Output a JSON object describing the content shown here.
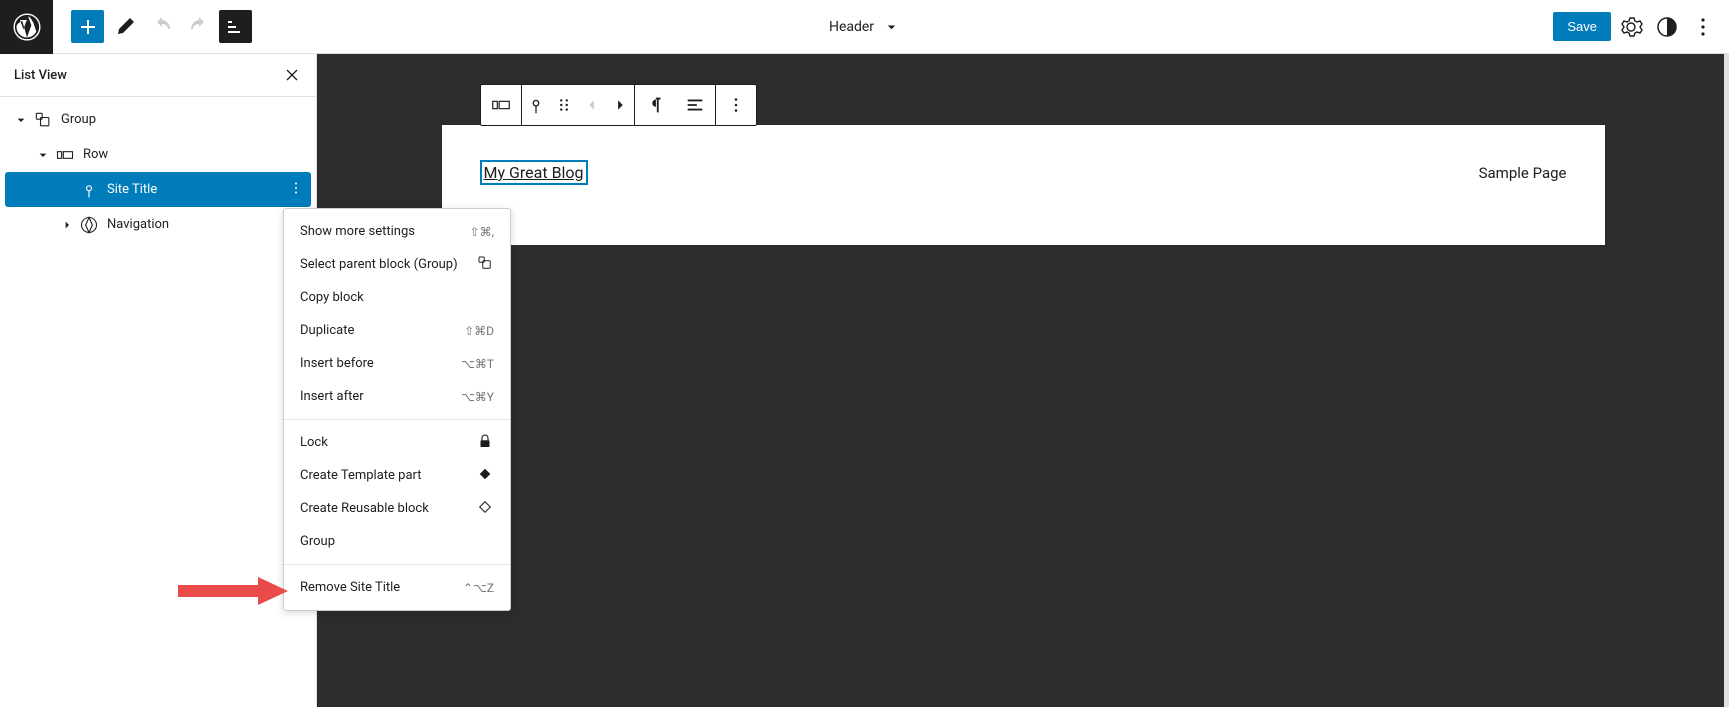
{
  "toolbar": {
    "template_name": "Header",
    "save_label": "Save"
  },
  "sidebar": {
    "panel_title": "List View",
    "tree": {
      "group_label": "Group",
      "row_label": "Row",
      "site_title_label": "Site Title",
      "navigation_label": "Navigation"
    }
  },
  "canvas": {
    "site_title_text": "My Great Blog",
    "nav_item_1": "Sample Page"
  },
  "context_menu": {
    "show_more": {
      "label": "Show more settings",
      "shortcut": "⇧⌘,"
    },
    "select_parent": {
      "label": "Select parent block (Group)"
    },
    "copy": {
      "label": "Copy block"
    },
    "duplicate": {
      "label": "Duplicate",
      "shortcut": "⇧⌘D"
    },
    "insert_before": {
      "label": "Insert before",
      "shortcut": "⌥⌘T"
    },
    "insert_after": {
      "label": "Insert after",
      "shortcut": "⌥⌘Y"
    },
    "lock": {
      "label": "Lock"
    },
    "create_template_part": {
      "label": "Create Template part"
    },
    "create_reusable": {
      "label": "Create Reusable block"
    },
    "group": {
      "label": "Group"
    },
    "remove": {
      "label": "Remove Site Title",
      "shortcut": "⌃⌥Z"
    }
  }
}
